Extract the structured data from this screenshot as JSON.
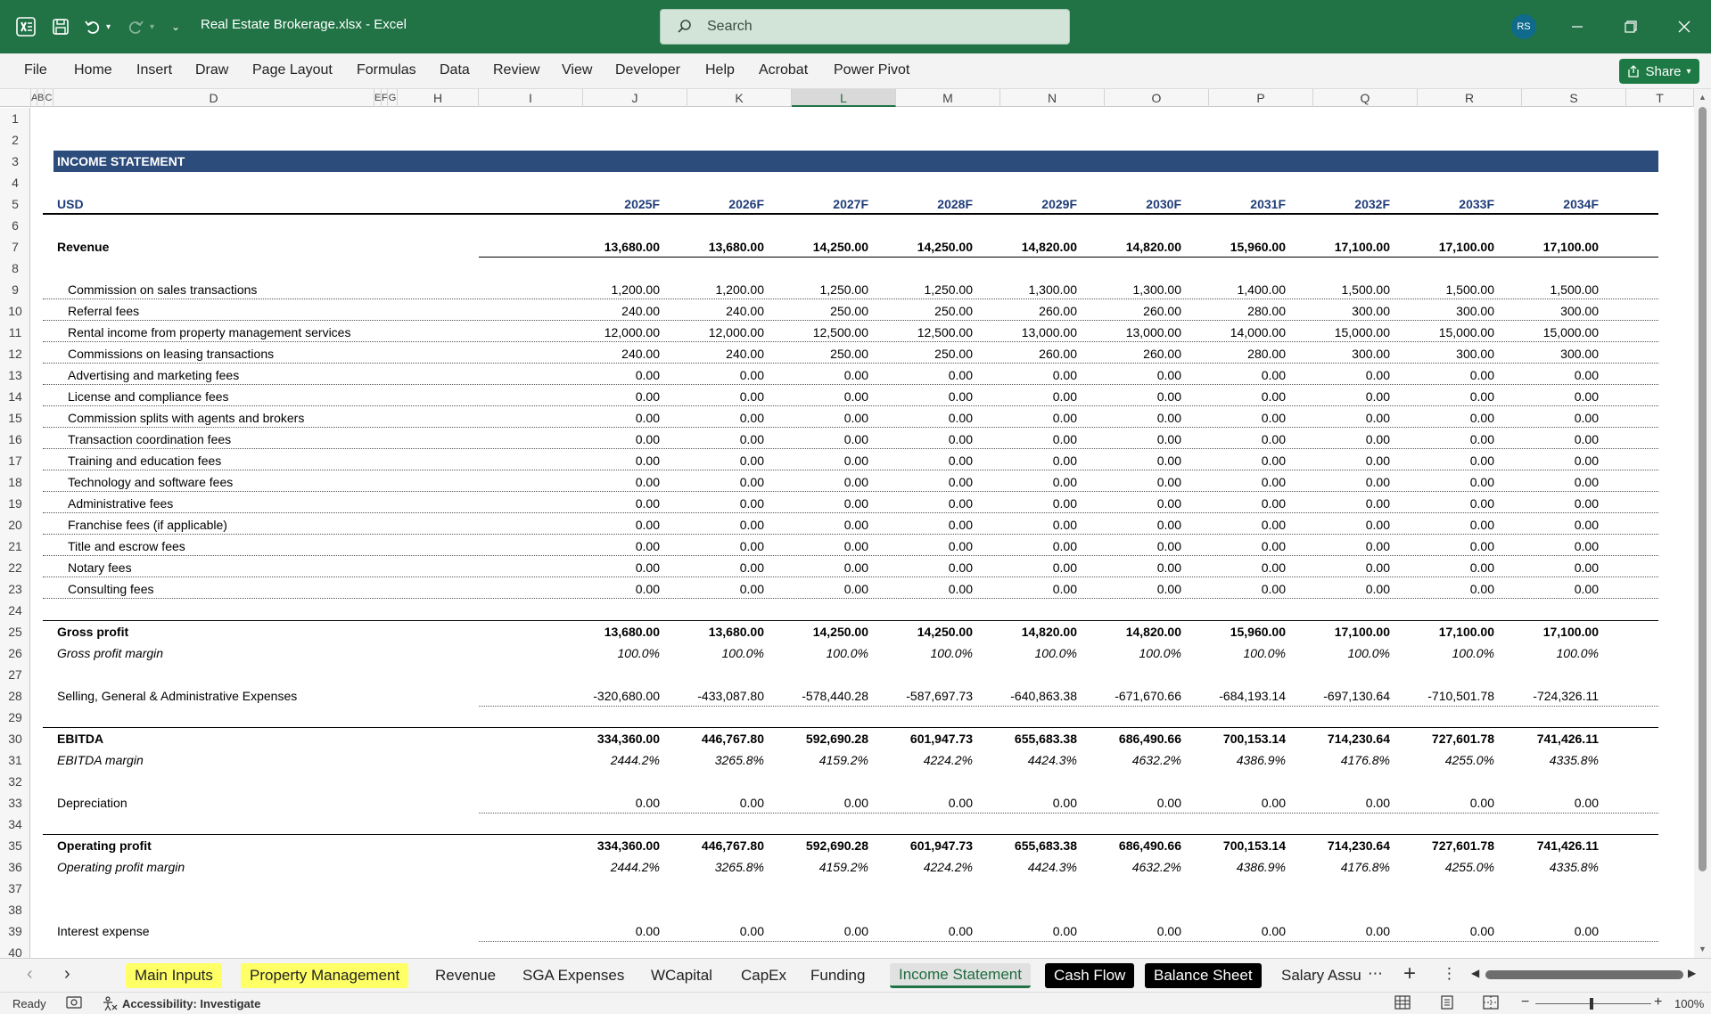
{
  "app": {
    "title": "Real Estate Brokerage.xlsx  -  Excel",
    "search_placeholder": "Search",
    "avatar_initials": "RS",
    "share_label": "Share"
  },
  "ribbon": {
    "tabs": [
      "File",
      "Home",
      "Insert",
      "Draw",
      "Page Layout",
      "Formulas",
      "Data",
      "Review",
      "View",
      "Developer",
      "Help",
      "Acrobat",
      "Power Pivot"
    ]
  },
  "columns": {
    "headers": [
      "A",
      "B",
      "C",
      "D",
      "E",
      "F",
      "G",
      "H",
      "I",
      "J",
      "K",
      "L",
      "M",
      "N",
      "O",
      "P",
      "Q",
      "R",
      "S",
      "T"
    ],
    "selected": "L"
  },
  "rows": {
    "numbers": [
      "1",
      "2",
      "3",
      "4",
      "5",
      "6",
      "7",
      "8",
      "9",
      "10",
      "11",
      "12",
      "13",
      "14",
      "15",
      "16",
      "17",
      "18",
      "19",
      "20",
      "21",
      "22",
      "23",
      "24",
      "25",
      "26",
      "27",
      "28",
      "29",
      "30",
      "31",
      "32",
      "33",
      "34",
      "35",
      "36",
      "37",
      "38",
      "39",
      "40"
    ]
  },
  "sheet": {
    "section_title": "INCOME STATEMENT",
    "currency_label": "USD",
    "years": [
      "2025F",
      "2026F",
      "2027F",
      "2028F",
      "2029F",
      "2030F",
      "2031F",
      "2032F",
      "2033F",
      "2034F"
    ],
    "revenue": {
      "label": "Revenue",
      "values": [
        "13,680.00",
        "13,680.00",
        "14,250.00",
        "14,250.00",
        "14,820.00",
        "14,820.00",
        "15,960.00",
        "17,100.00",
        "17,100.00",
        "17,100.00"
      ]
    },
    "revenue_items": [
      {
        "label": "Commission on sales transactions",
        "values": [
          "1,200.00",
          "1,200.00",
          "1,250.00",
          "1,250.00",
          "1,300.00",
          "1,300.00",
          "1,400.00",
          "1,500.00",
          "1,500.00",
          "1,500.00"
        ]
      },
      {
        "label": "Referral fees",
        "values": [
          "240.00",
          "240.00",
          "250.00",
          "250.00",
          "260.00",
          "260.00",
          "280.00",
          "300.00",
          "300.00",
          "300.00"
        ]
      },
      {
        "label": "Rental income from property management services",
        "values": [
          "12,000.00",
          "12,000.00",
          "12,500.00",
          "12,500.00",
          "13,000.00",
          "13,000.00",
          "14,000.00",
          "15,000.00",
          "15,000.00",
          "15,000.00"
        ]
      },
      {
        "label": "Commissions on leasing transactions",
        "values": [
          "240.00",
          "240.00",
          "250.00",
          "250.00",
          "260.00",
          "260.00",
          "280.00",
          "300.00",
          "300.00",
          "300.00"
        ]
      },
      {
        "label": "Advertising and marketing fees",
        "values": [
          "0.00",
          "0.00",
          "0.00",
          "0.00",
          "0.00",
          "0.00",
          "0.00",
          "0.00",
          "0.00",
          "0.00"
        ]
      },
      {
        "label": "License and compliance fees",
        "values": [
          "0.00",
          "0.00",
          "0.00",
          "0.00",
          "0.00",
          "0.00",
          "0.00",
          "0.00",
          "0.00",
          "0.00"
        ]
      },
      {
        "label": "Commission splits with agents and brokers",
        "values": [
          "0.00",
          "0.00",
          "0.00",
          "0.00",
          "0.00",
          "0.00",
          "0.00",
          "0.00",
          "0.00",
          "0.00"
        ]
      },
      {
        "label": "Transaction coordination fees",
        "values": [
          "0.00",
          "0.00",
          "0.00",
          "0.00",
          "0.00",
          "0.00",
          "0.00",
          "0.00",
          "0.00",
          "0.00"
        ]
      },
      {
        "label": "Training and education fees",
        "values": [
          "0.00",
          "0.00",
          "0.00",
          "0.00",
          "0.00",
          "0.00",
          "0.00",
          "0.00",
          "0.00",
          "0.00"
        ]
      },
      {
        "label": "Technology and software fees",
        "values": [
          "0.00",
          "0.00",
          "0.00",
          "0.00",
          "0.00",
          "0.00",
          "0.00",
          "0.00",
          "0.00",
          "0.00"
        ]
      },
      {
        "label": "Administrative fees",
        "values": [
          "0.00",
          "0.00",
          "0.00",
          "0.00",
          "0.00",
          "0.00",
          "0.00",
          "0.00",
          "0.00",
          "0.00"
        ]
      },
      {
        "label": "Franchise fees (if applicable)",
        "values": [
          "0.00",
          "0.00",
          "0.00",
          "0.00",
          "0.00",
          "0.00",
          "0.00",
          "0.00",
          "0.00",
          "0.00"
        ]
      },
      {
        "label": "Title and escrow fees",
        "values": [
          "0.00",
          "0.00",
          "0.00",
          "0.00",
          "0.00",
          "0.00",
          "0.00",
          "0.00",
          "0.00",
          "0.00"
        ]
      },
      {
        "label": "Notary fees",
        "values": [
          "0.00",
          "0.00",
          "0.00",
          "0.00",
          "0.00",
          "0.00",
          "0.00",
          "0.00",
          "0.00",
          "0.00"
        ]
      },
      {
        "label": "Consulting fees",
        "values": [
          "0.00",
          "0.00",
          "0.00",
          "0.00",
          "0.00",
          "0.00",
          "0.00",
          "0.00",
          "0.00",
          "0.00"
        ]
      }
    ],
    "gross_profit": {
      "label": "Gross profit",
      "values": [
        "13,680.00",
        "13,680.00",
        "14,250.00",
        "14,250.00",
        "14,820.00",
        "14,820.00",
        "15,960.00",
        "17,100.00",
        "17,100.00",
        "17,100.00"
      ]
    },
    "gross_margin": {
      "label": "Gross profit margin",
      "values": [
        "100.0%",
        "100.0%",
        "100.0%",
        "100.0%",
        "100.0%",
        "100.0%",
        "100.0%",
        "100.0%",
        "100.0%",
        "100.0%"
      ]
    },
    "sga": {
      "label": "Selling, General & Administrative Expenses",
      "values": [
        "-320,680.00",
        "-433,087.80",
        "-578,440.28",
        "-587,697.73",
        "-640,863.38",
        "-671,670.66",
        "-684,193.14",
        "-697,130.64",
        "-710,501.78",
        "-724,326.11"
      ]
    },
    "ebitda": {
      "label": "EBITDA",
      "values": [
        "334,360.00",
        "446,767.80",
        "592,690.28",
        "601,947.73",
        "655,683.38",
        "686,490.66",
        "700,153.14",
        "714,230.64",
        "727,601.78",
        "741,426.11"
      ]
    },
    "ebitda_margin": {
      "label": "EBITDA margin",
      "values": [
        "2444.2%",
        "3265.8%",
        "4159.2%",
        "4224.2%",
        "4424.3%",
        "4632.2%",
        "4386.9%",
        "4176.8%",
        "4255.0%",
        "4335.8%"
      ]
    },
    "depreciation": {
      "label": "Depreciation",
      "values": [
        "0.00",
        "0.00",
        "0.00",
        "0.00",
        "0.00",
        "0.00",
        "0.00",
        "0.00",
        "0.00",
        "0.00"
      ]
    },
    "operating_profit": {
      "label": "Operating profit",
      "values": [
        "334,360.00",
        "446,767.80",
        "592,690.28",
        "601,947.73",
        "655,683.38",
        "686,490.66",
        "700,153.14",
        "714,230.64",
        "727,601.78",
        "741,426.11"
      ]
    },
    "operating_margin": {
      "label": "Operating profit margin",
      "values": [
        "2444.2%",
        "3265.8%",
        "4159.2%",
        "4224.2%",
        "4424.3%",
        "4632.2%",
        "4386.9%",
        "4176.8%",
        "4255.0%",
        "4335.8%"
      ]
    },
    "interest": {
      "label": "Interest expense",
      "values": [
        "0.00",
        "0.00",
        "0.00",
        "0.00",
        "0.00",
        "0.00",
        "0.00",
        "0.00",
        "0.00",
        "0.00"
      ]
    }
  },
  "sheet_tabs": [
    {
      "label": "Main Inputs",
      "style": "yellow"
    },
    {
      "label": "Property Management",
      "style": "yellow"
    },
    {
      "label": "Revenue",
      "style": "plain"
    },
    {
      "label": "SGA Expenses",
      "style": "plain"
    },
    {
      "label": "WCapital",
      "style": "plain"
    },
    {
      "label": "CapEx",
      "style": "plain"
    },
    {
      "label": "Funding",
      "style": "plain"
    },
    {
      "label": "Income Statement",
      "style": "active"
    },
    {
      "label": "Cash Flow",
      "style": "dark"
    },
    {
      "label": "Balance Sheet",
      "style": "dark"
    },
    {
      "label": "Salary Assu",
      "style": "plain"
    }
  ],
  "status": {
    "ready": "Ready",
    "accessibility": "Accessibility: Investigate",
    "zoom": "100%"
  }
}
